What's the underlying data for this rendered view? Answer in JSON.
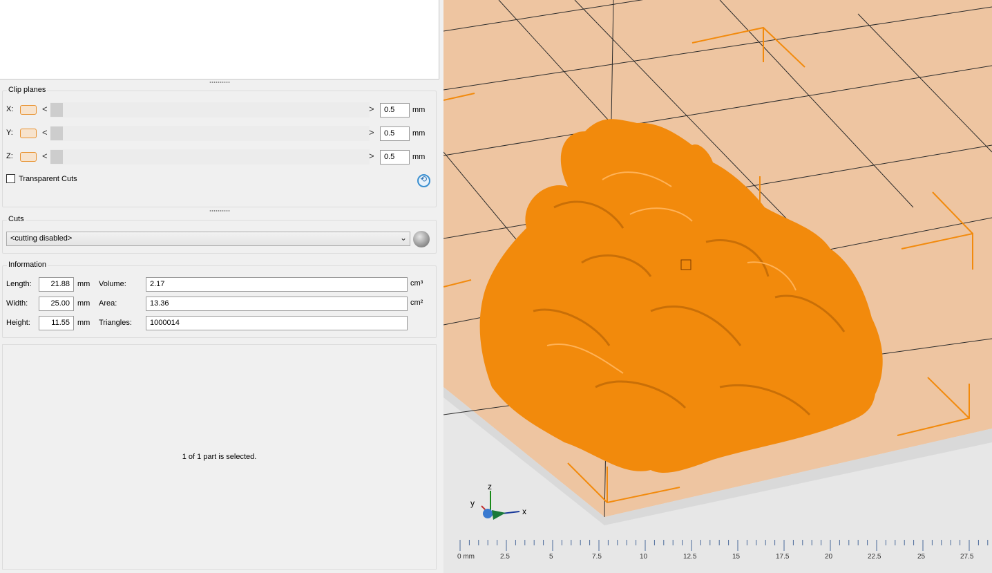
{
  "clip_planes": {
    "title": "Clip planes",
    "rows": [
      {
        "axis": "X:",
        "value": "0.5",
        "unit": "mm"
      },
      {
        "axis": "Y:",
        "value": "0.5",
        "unit": "mm"
      },
      {
        "axis": "Z:",
        "value": "0.5",
        "unit": "mm"
      }
    ],
    "arrow_left": "<",
    "arrow_right": ">",
    "transparent_cuts_label": "Transparent Cuts"
  },
  "cuts": {
    "title": "Cuts",
    "selected": "<cutting disabled>"
  },
  "information": {
    "title": "Information",
    "length_label": "Length:",
    "length": "21.88",
    "width_label": "Width:",
    "width": "25.00",
    "height_label": "Height:",
    "height": "11.55",
    "dim_unit": "mm",
    "volume_label": "Volume:",
    "volume": "2.17",
    "volume_unit": "cm³",
    "area_label": "Area:",
    "area": "13.36",
    "area_unit": "cm²",
    "triangles_label": "Triangles:",
    "triangles": "1000014"
  },
  "status": {
    "selection_text": "1 of 1 part is selected."
  },
  "viewport": {
    "model_color": "#f28a0c",
    "bed_color": "#eec5a1",
    "axis_labels": {
      "z": "z",
      "y": "y",
      "x": "x"
    },
    "ruler": [
      "0 mm",
      "2.5",
      "5",
      "7.5",
      "10",
      "12.5",
      "15",
      "17.5",
      "20",
      "22.5",
      "25",
      "27.5"
    ]
  }
}
